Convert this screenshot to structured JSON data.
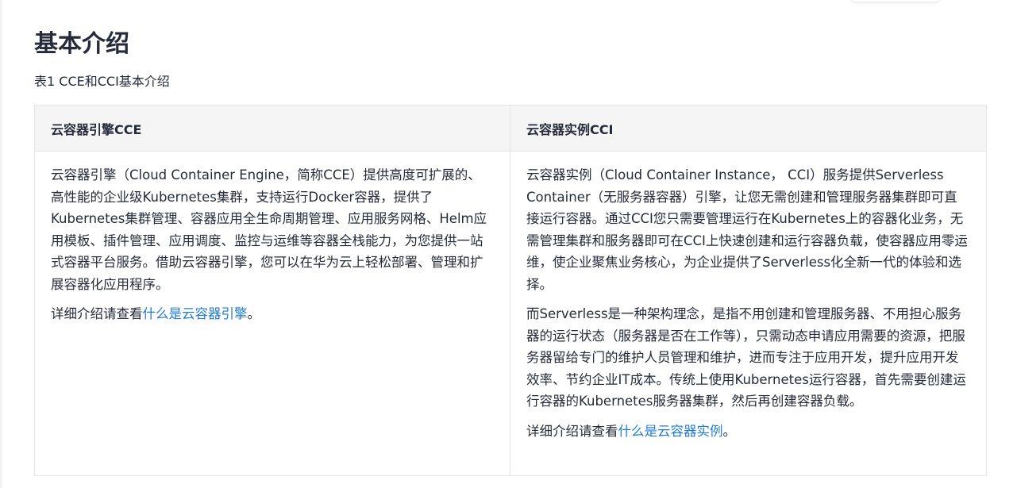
{
  "page": {
    "title": "基本介绍",
    "table_caption": "表1 CCE和CCI基本介绍"
  },
  "table": {
    "headers": [
      "云容器引擎CCE",
      "云容器实例CCI"
    ],
    "cce": {
      "paragraph1": "云容器引擎（Cloud Container Engine，简称CCE）提供高度可扩展的、高性能的企业级Kubernetes集群，支持运行Docker容器，提供了Kubernetes集群管理、容器应用全生命周期管理、应用服务网格、Helm应用模板、插件管理、应用调度、监控与运维等容器全栈能力，为您提供一站式容器平台服务。借助云容器引擎，您可以在华为云上轻松部署、管理和扩展容器化应用程序。",
      "detail_prefix": "详细介绍请查看",
      "detail_link": "什么是云容器引擎",
      "detail_suffix": "。"
    },
    "cci": {
      "paragraph1": "云容器实例（Cloud Container Instance， CCI）服务提供Serverless Container（无服务器容器）引擎，让您无需创建和管理服务器集群即可直接运行容器。通过CCI您只需要管理运行在Kubernetes上的容器化业务，无需管理集群和服务器即可在CCI上快速创建和运行容器负载，使容器应用零运维，使企业聚焦业务核心，为企业提供了Serverless化全新一代的体验和选择。",
      "paragraph2": "而Serverless是一种架构理念，是指不用创建和管理服务器、不用担心服务器的运行状态（服务器是否在工作等），只需动态申请应用需要的资源，把服务器留给专门的维护人员管理和维护，进而专注于应用开发，提升应用开发效率、节约企业IT成本。传统上使用Kubernetes运行容器，首先需要创建运行容器的Kubernetes服务器集群，然后再创建容器负载。",
      "detail_prefix": "详细介绍请查看",
      "detail_link": "什么是云容器实例",
      "detail_suffix": "。"
    }
  },
  "colors": {
    "text": "#252b3a",
    "link": "#1f7ad6",
    "header_bg": "#f5f5f5",
    "border": "#e5e5e5"
  }
}
